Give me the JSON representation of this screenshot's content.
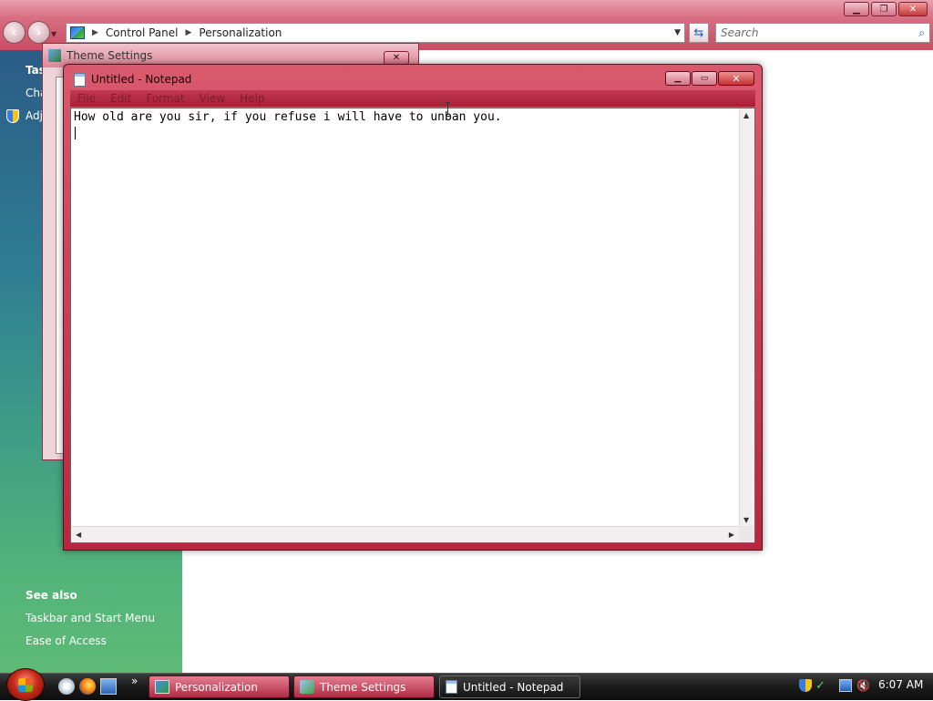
{
  "control_panel": {
    "breadcrumb": [
      "Control Panel",
      "Personalization"
    ],
    "search_placeholder": "Search",
    "task_pane": {
      "tasks_heading": "Tas",
      "task_items": [
        "Cha",
        "Adj"
      ],
      "see_also_heading": "See also",
      "see_also_items": [
        "Taskbar and Start Menu",
        "Ease of Access"
      ]
    }
  },
  "theme_settings": {
    "title": "Theme Settings"
  },
  "notepad": {
    "title": "Untitled - Notepad",
    "menu": [
      "File",
      "Edit",
      "Format",
      "View",
      "Help"
    ],
    "content": "How old are you sir, if you refuse i will have to unban you."
  },
  "taskbar": {
    "buttons": [
      {
        "label": "Personalization",
        "icon": "control-panel-icon",
        "active": false
      },
      {
        "label": "Theme Settings",
        "icon": "theme-settings-icon",
        "active": false
      },
      {
        "label": "Untitled - Notepad",
        "icon": "notepad-icon",
        "active": true
      }
    ],
    "quick_launch_more": "»",
    "clock": "6:07 AM"
  },
  "colors": {
    "window_frame": "#c84d63",
    "taskbar": "#1c1c1c",
    "task_pane_top": "#2b5c86",
    "task_pane_bottom": "#5dba76"
  }
}
